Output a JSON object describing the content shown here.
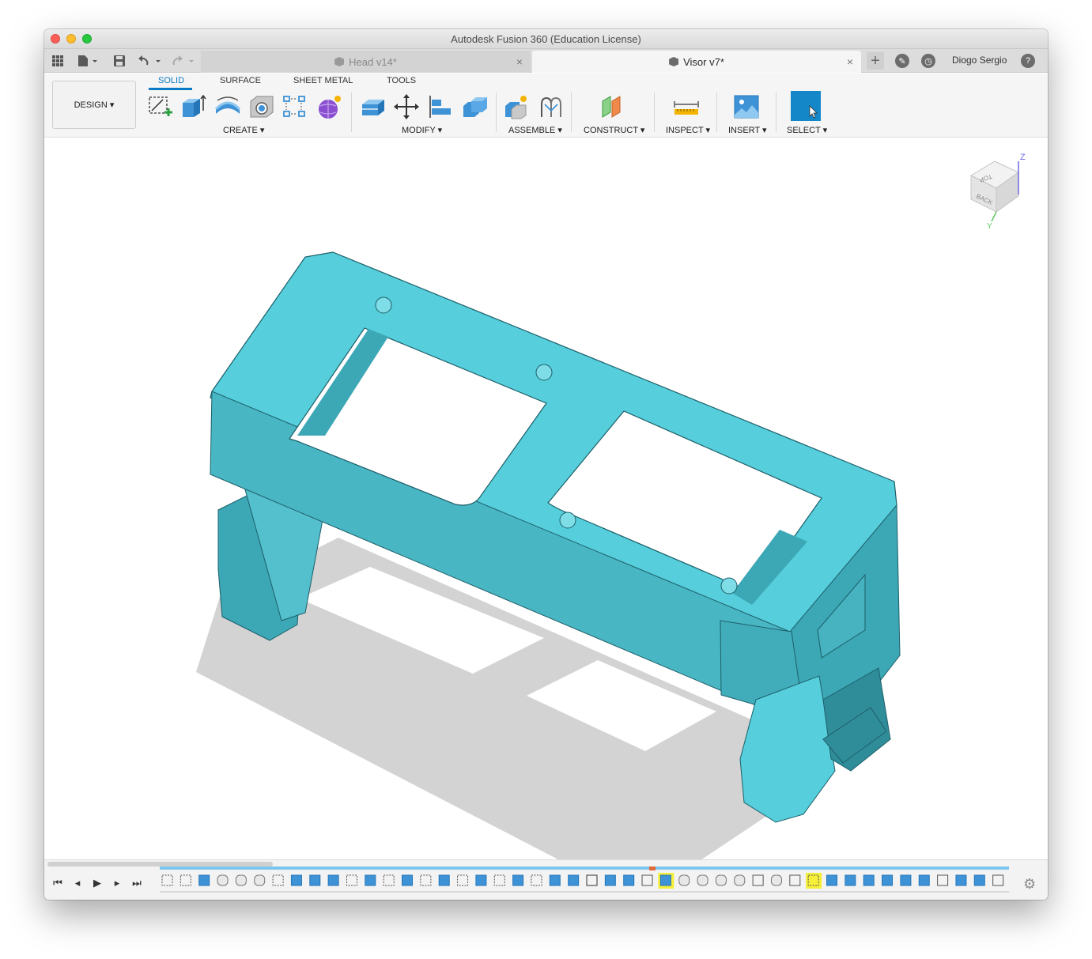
{
  "window": {
    "title": "Autodesk Fusion 360 (Education License)"
  },
  "tabs": {
    "items": [
      {
        "label": "Head v14*",
        "active": false
      },
      {
        "label": "Visor v7*",
        "active": true
      }
    ],
    "close_glyph": "×",
    "new_tab_glyph": "+"
  },
  "user": {
    "name": "Diogo Sergio",
    "help_glyph": "?"
  },
  "toolbar": {
    "workspace_label": "DESIGN ▾",
    "ribbon_tabs": [
      "SOLID",
      "SURFACE",
      "SHEET METAL",
      "TOOLS"
    ],
    "active_tab": "SOLID",
    "groups": {
      "create": "CREATE ▾",
      "modify": "MODIFY ▾",
      "assemble": "ASSEMBLE ▾",
      "construct": "CONSTRUCT ▾",
      "inspect": "INSPECT ▾",
      "insert": "INSERT ▾",
      "select": "SELECT ▾"
    },
    "icons": {
      "create": [
        "create-sketch-icon",
        "extrude-icon",
        "revolve-icon",
        "hole-icon",
        "rectangular-pattern-icon",
        "create-form-icon"
      ],
      "modify": [
        "press-pull-icon",
        "move-copy-icon",
        "align-icon",
        "combine-icon"
      ],
      "assemble": [
        "new-component-icon",
        "joint-icon"
      ],
      "construct": [
        "offset-plane-icon"
      ],
      "inspect": [
        "measure-icon"
      ],
      "insert": [
        "insert-image-icon"
      ],
      "select": [
        "select-icon"
      ]
    },
    "colors": {
      "accent": "#0b79c4",
      "model": "#4fc9d6",
      "select_bg": "#1487c8"
    }
  },
  "viewcube": {
    "top": "TOP",
    "back": "BACK",
    "left": "LEFT",
    "z": "Z",
    "y": "Y"
  },
  "timeline": {
    "controls": [
      "⏮",
      "◂",
      "▶",
      "▸",
      "⏭"
    ],
    "features": [
      "sketch",
      "sketch",
      "extrude",
      "fillet",
      "fillet",
      "fillet",
      "sketch",
      "extrude",
      "image",
      "image",
      "sketch",
      "extrude",
      "sketch",
      "extrude",
      "sketch",
      "extrude",
      "sketch",
      "extrude",
      "sketch",
      "extrude",
      "sketch",
      "image",
      "press-pull",
      "move",
      "combine",
      "align",
      "pattern",
      "extrude-highlighted",
      "fillet",
      "component",
      "joint",
      "component",
      "plane",
      "component",
      "plane",
      "sketch-highlighted",
      "extrude",
      "extrude",
      "extrude",
      "extrude",
      "extrude",
      "extrude",
      "plane",
      "extrude",
      "extrude",
      "plane"
    ],
    "settings_icon": "gear-icon"
  }
}
